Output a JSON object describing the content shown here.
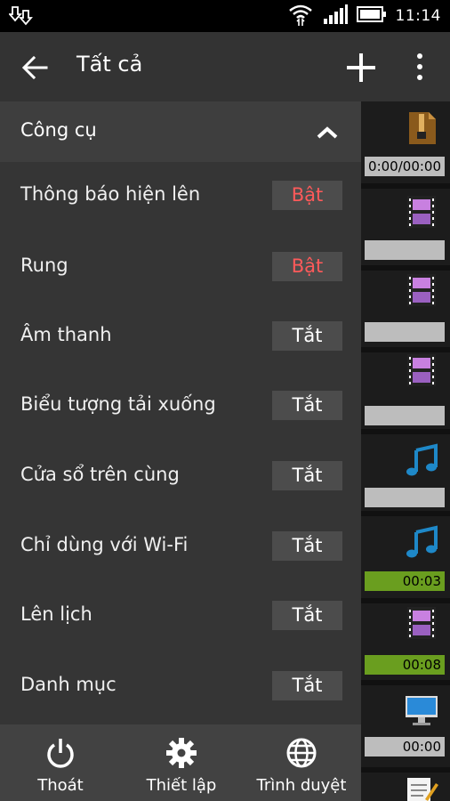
{
  "status_bar": {
    "time": "11:14"
  },
  "toolbar": {
    "title": "Tất cả"
  },
  "drawer": {
    "section_title": "Công cụ",
    "rows": [
      {
        "label": "Thông báo hiện lên",
        "value": "Bật",
        "on": true
      },
      {
        "label": "Rung",
        "value": "Bật",
        "on": true
      },
      {
        "label": "Âm thanh",
        "value": "Tắt",
        "on": false
      },
      {
        "label": "Biểu tượng tải xuống",
        "value": "Tắt",
        "on": false
      },
      {
        "label": "Cửa sổ trên cùng",
        "value": "Tắt",
        "on": false
      },
      {
        "label": "Chỉ dùng với Wi-Fi",
        "value": "Tắt",
        "on": false
      },
      {
        "label": "Lên lịch",
        "value": "Tắt",
        "on": false
      },
      {
        "label": "Danh mục",
        "value": "Tắt",
        "on": false
      }
    ]
  },
  "bottom_bar": {
    "exit_label": "Thoát",
    "settings_label": "Thiết lập",
    "browser_label": "Trình duyệt"
  },
  "background_list": {
    "items": [
      {
        "icon": "archive-icon",
        "bar_text": "0:00/00:00",
        "bar_color": "gray"
      },
      {
        "icon": "video-icon",
        "bar_text": "",
        "bar_color": "gray"
      },
      {
        "icon": "video-icon",
        "bar_text": "",
        "bar_color": "gray"
      },
      {
        "icon": "video-icon",
        "bar_text": "",
        "bar_color": "gray"
      },
      {
        "icon": "music-icon",
        "bar_text": "",
        "bar_color": "gray"
      },
      {
        "icon": "music-icon",
        "bar_text": "00:03",
        "bar_color": "green"
      },
      {
        "icon": "video-icon",
        "bar_text": "00:08",
        "bar_color": "green"
      },
      {
        "icon": "monitor-icon",
        "bar_text": "00:00",
        "bar_color": "gray"
      },
      {
        "icon": "document-icon",
        "bar_text": "",
        "bar_color": "gray"
      }
    ]
  },
  "colors": {
    "on": "#ff5a5a",
    "accent_blue": "#1e88c8",
    "progress_green": "#6a9e1f"
  }
}
